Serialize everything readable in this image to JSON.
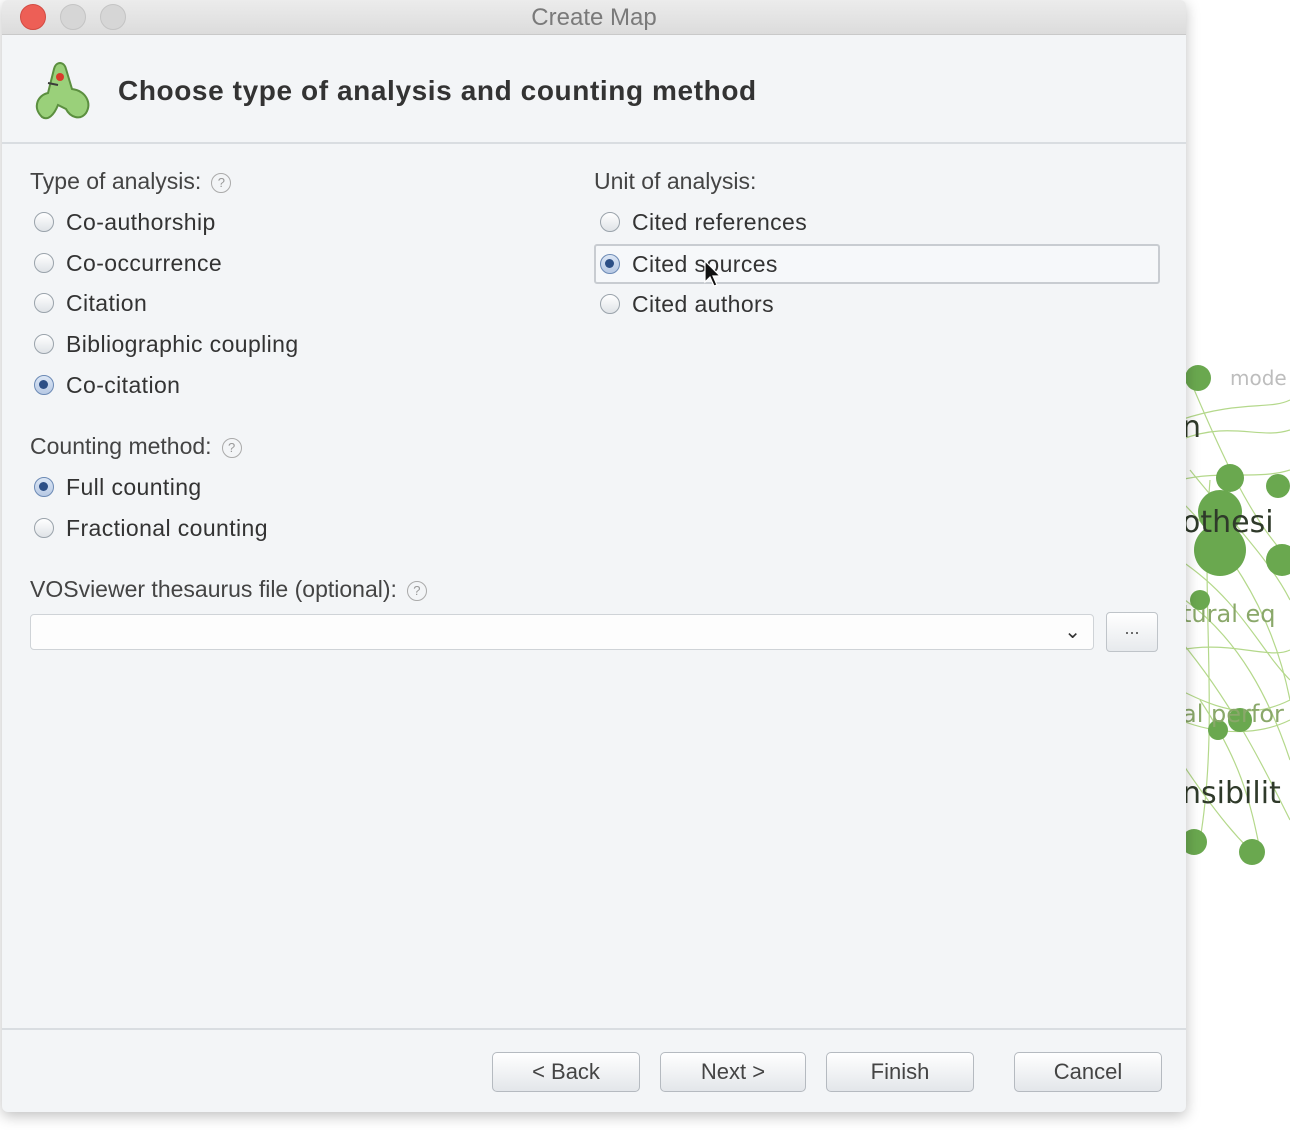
{
  "window": {
    "title": "Create Map"
  },
  "header": {
    "title": "Choose type of analysis and counting method"
  },
  "type_of_analysis": {
    "label": "Type of analysis:",
    "options": [
      "Co-authorship",
      "Co-occurrence",
      "Citation",
      "Bibliographic coupling",
      "Co-citation"
    ],
    "selected": "Co-citation"
  },
  "unit_of_analysis": {
    "label": "Unit of analysis:",
    "options": [
      "Cited references",
      "Cited sources",
      "Cited authors"
    ],
    "selected": "Cited sources"
  },
  "counting_method": {
    "label": "Counting method:",
    "options": [
      "Full counting",
      "Fractional counting"
    ],
    "selected": "Full counting"
  },
  "thesaurus": {
    "label": "VOSviewer thesaurus file (optional):",
    "value": "",
    "browse_label": "..."
  },
  "help_glyph": "?",
  "buttons": {
    "back": "< Back",
    "next": "Next >",
    "finish": "Finish",
    "cancel": "Cancel"
  },
  "background_words": [
    "mode",
    "n",
    "othesi",
    "tural eq",
    "al perfor",
    "nsibilit"
  ],
  "colors": {
    "accent_radio": "#2c4f86",
    "close": "#ed5f56",
    "network_green": "#6aa84f"
  }
}
